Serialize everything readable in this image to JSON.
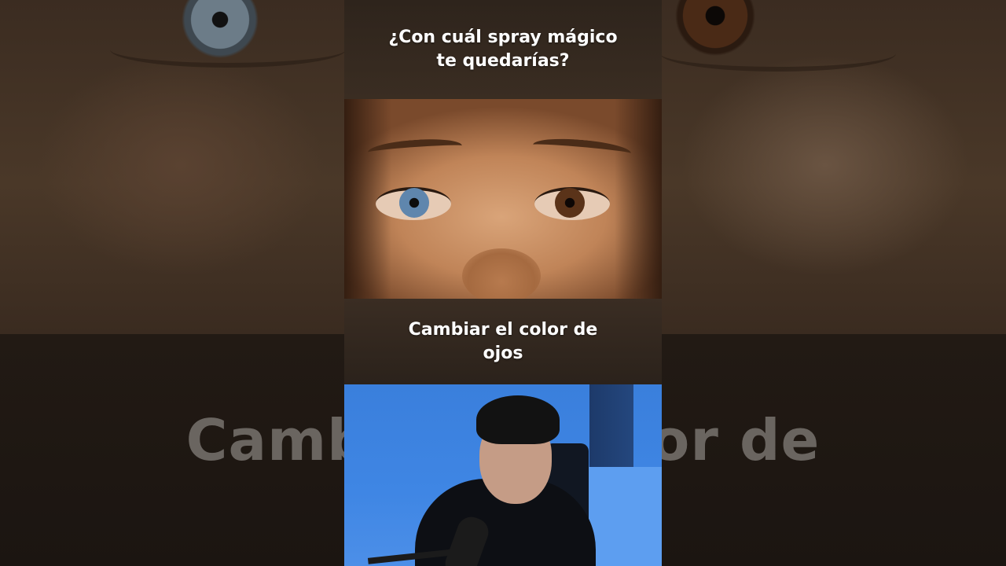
{
  "question_caption": "¿Con cuál spray mágico\nte quedarías?",
  "answer_caption": "Cambiar el color de\nojos",
  "background_caption": "Cambiar el color de"
}
